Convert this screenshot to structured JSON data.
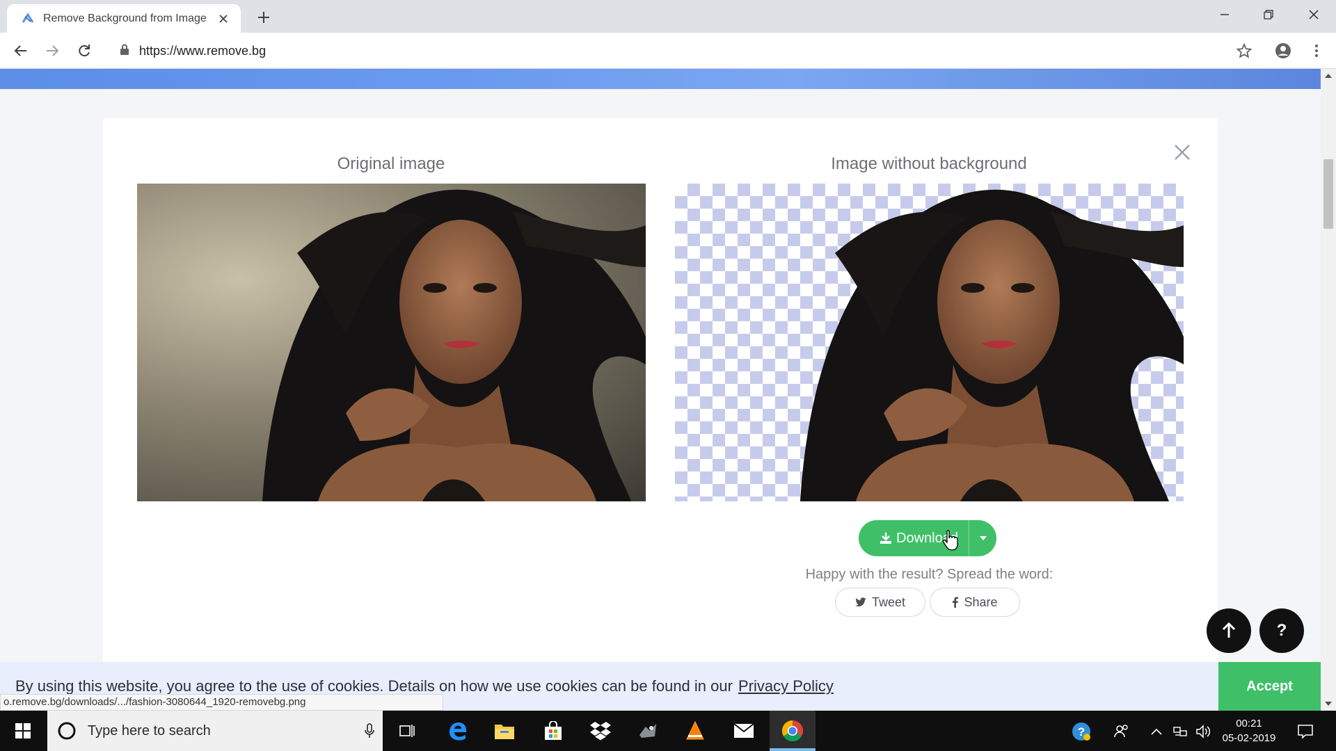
{
  "browser": {
    "tab_title": "Remove Background from Image",
    "url": "https://www.remove.bg"
  },
  "page": {
    "original_title": "Original image",
    "result_title": "Image without background",
    "download_label": "Download",
    "happy_text": "Happy with the result? Spread the word:",
    "tweet_label": "Tweet",
    "share_label": "Share",
    "help_label": "?"
  },
  "cookie": {
    "text": "By using this website, you agree to the use of cookies. Details on how we use cookies can be found in our",
    "link": "Privacy Policy",
    "accept": "Accept"
  },
  "status_url": "o.remove.bg/downloads/.../fashion-3080644_1920-removebg.png",
  "taskbar": {
    "search_placeholder": "Type here to search",
    "time": "00:21",
    "date": "05-02-2019"
  },
  "colors": {
    "accent_green": "#3fc068",
    "checker": "#c7cbeb",
    "hero_blue": "#6a9af0"
  }
}
